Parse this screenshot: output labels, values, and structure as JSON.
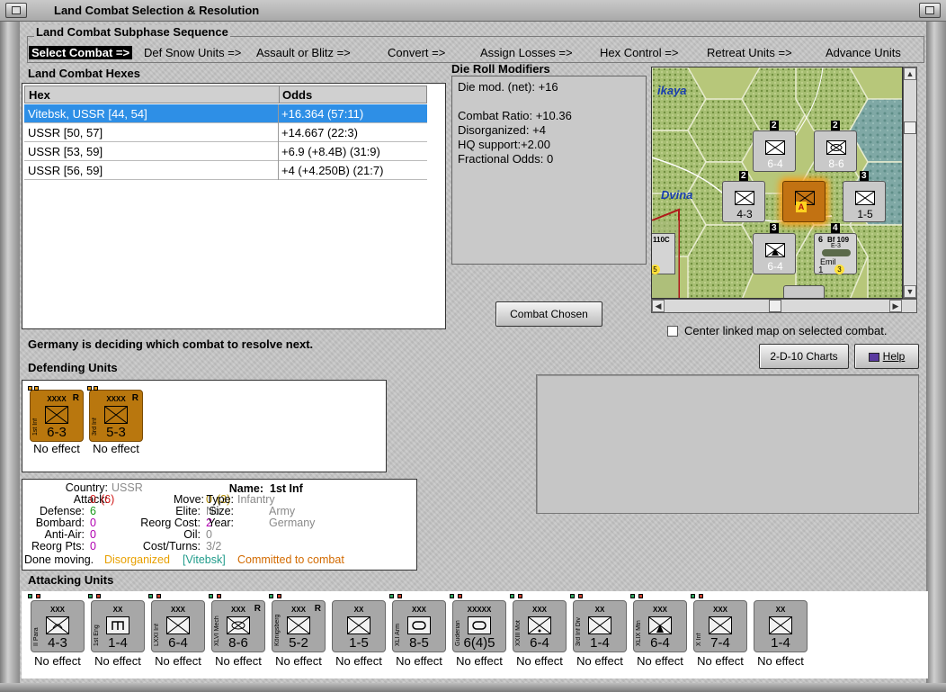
{
  "window": {
    "title": "Land Combat Selection & Resolution"
  },
  "sequence": {
    "heading": "Land Combat Subphase Sequence",
    "steps": [
      "Select Combat =>",
      "Def Snow Units =>",
      "Assault or Blitz =>",
      "Convert =>",
      "Assign Losses =>",
      "Hex Control =>",
      "Retreat Units =>",
      "Advance Units"
    ]
  },
  "hexes": {
    "heading": "Land Combat Hexes",
    "col_hex": "Hex",
    "col_odds": "Odds",
    "rows": [
      {
        "hex": "Vitebsk, USSR [44, 54]",
        "odds": "+16.364 (57:11)"
      },
      {
        "hex": "USSR [50, 57]",
        "odds": "+14.667 (22:3)"
      },
      {
        "hex": "USSR [53, 59]",
        "odds": "+6.9 (+8.4B) (31:9)"
      },
      {
        "hex": "USSR [56, 59]",
        "odds": "+4 (+4.250B) (21:7)"
      }
    ]
  },
  "die_roll": {
    "heading": "Die Roll Modifiers",
    "lines": [
      "Die mod. (net): +16",
      "Combat Ratio: +10.36",
      "Disorganized: +4",
      "HQ support:+2.00",
      "Fractional Odds: 0"
    ]
  },
  "map": {
    "labels": [
      "ikaya",
      "Dvina"
    ],
    "counters": [
      {
        "str": "6-4",
        "stack": "2"
      },
      {
        "str": "8-6",
        "stack": "2"
      },
      {
        "str": "4-3",
        "stack": "2"
      },
      {
        "str": "1-5",
        "stack": "3"
      },
      {
        "str": "6-4",
        "stack": "3"
      },
      {
        "str": "Emil",
        "stack": "4"
      }
    ],
    "partial_texts": [
      "110C",
      "Bf 109",
      "E-3",
      "6",
      "1",
      "3",
      "5"
    ]
  },
  "buttons": {
    "combat_chosen": "Combat Chosen",
    "charts": "2-D-10 Charts",
    "help": "Help"
  },
  "center_linked": "Center linked map on selected combat.",
  "status": "Germany is deciding which combat to resolve next.",
  "defending": {
    "heading": "Defending Units",
    "units": [
      {
        "name": "1st Inf",
        "size": "XXXX",
        "str": "6-3",
        "flag": "R",
        "effect": "No effect"
      },
      {
        "name": "3rd Inf",
        "size": "XXXX",
        "str": "5-3",
        "flag": "R",
        "effect": "No effect"
      }
    ]
  },
  "info": {
    "country_l": "Country:",
    "country_v": "USSR",
    "name_l": "Name:",
    "name_v": "1st Inf",
    "attack_l": "Attack:",
    "attack_v": "0",
    "attack_v2": "(6)",
    "move_l": "Move:",
    "move_v": "0",
    "move_v2": "(3)",
    "type_l": "Type:",
    "type_v": "Infantry",
    "defense_l": "Defense:",
    "defense_v": "6",
    "elite_l": "Elite:",
    "elite_v": "No",
    "size_l": "Size:",
    "size_v": "Army",
    "bombard_l": "Bombard:",
    "bombard_v": "0",
    "reorg_l": "Reorg Cost:",
    "reorg_v": "2",
    "year_l": "Year:",
    "year_v": "Germany",
    "aa_l": "Anti-Air:",
    "aa_v": "0",
    "oil_l": "Oil:",
    "oil_v": "0",
    "rp_l": "Reorg Pts:",
    "rp_v": "0",
    "ct_l": "Cost/Turns:",
    "ct_v": "3/2",
    "done": "Done moving.",
    "disorg": "Disorganized",
    "loc": "[Vitebsk]",
    "committed": "Committed to combat"
  },
  "attacking": {
    "heading": "Attacking Units",
    "units": [
      {
        "name": "II Para",
        "size": "XXX",
        "str": "4-3",
        "flag": "",
        "effect": "No effect"
      },
      {
        "name": "1st Eng",
        "size": "XX",
        "str": "1-4",
        "flag": "",
        "effect": "No effect"
      },
      {
        "name": "LXXI Inf",
        "size": "XXX",
        "str": "6-4",
        "flag": "",
        "effect": "No effect"
      },
      {
        "name": "XLVI Mech",
        "size": "XXX",
        "str": "8-6",
        "flag": "R",
        "effect": "No effect"
      },
      {
        "name": "Königsberg",
        "size": "XXX",
        "str": "5-2",
        "flag": "R",
        "effect": "No effect"
      },
      {
        "name": "",
        "size": "XX",
        "str": "1-5",
        "flag": "",
        "effect": "No effect"
      },
      {
        "name": "XLI Arm",
        "size": "XXX",
        "str": "8-5",
        "flag": "",
        "effect": "No effect"
      },
      {
        "name": "Guderian",
        "size": "XXXXX",
        "str": "6(4)5",
        "flag": "",
        "effect": "No effect"
      },
      {
        "name": "XXIII Mot",
        "size": "XXX",
        "str": "6-4",
        "flag": "",
        "effect": "No effect"
      },
      {
        "name": "3rd Inf Div",
        "size": "XX",
        "str": "1-4",
        "flag": "",
        "effect": "No effect"
      },
      {
        "name": "XLIX Mtn",
        "size": "XXX",
        "str": "6-4",
        "flag": "",
        "effect": "No effect"
      },
      {
        "name": "X Inf",
        "size": "XXX",
        "str": "7-4",
        "flag": "",
        "effect": "No effect"
      },
      {
        "name": "",
        "size": "XX",
        "str": "1-4",
        "flag": "",
        "effect": "No effect"
      }
    ]
  },
  "colors": {
    "selection": "#2e8fe6",
    "defender": "#b9770e",
    "attacker": "#a7a7a7",
    "disorganized": "#e8a000",
    "location": "#1f9b8a",
    "committed": "#d26a00",
    "attack_red": "#d01818",
    "defense_green": "#1a9a1a",
    "purple": "#b000b0"
  }
}
